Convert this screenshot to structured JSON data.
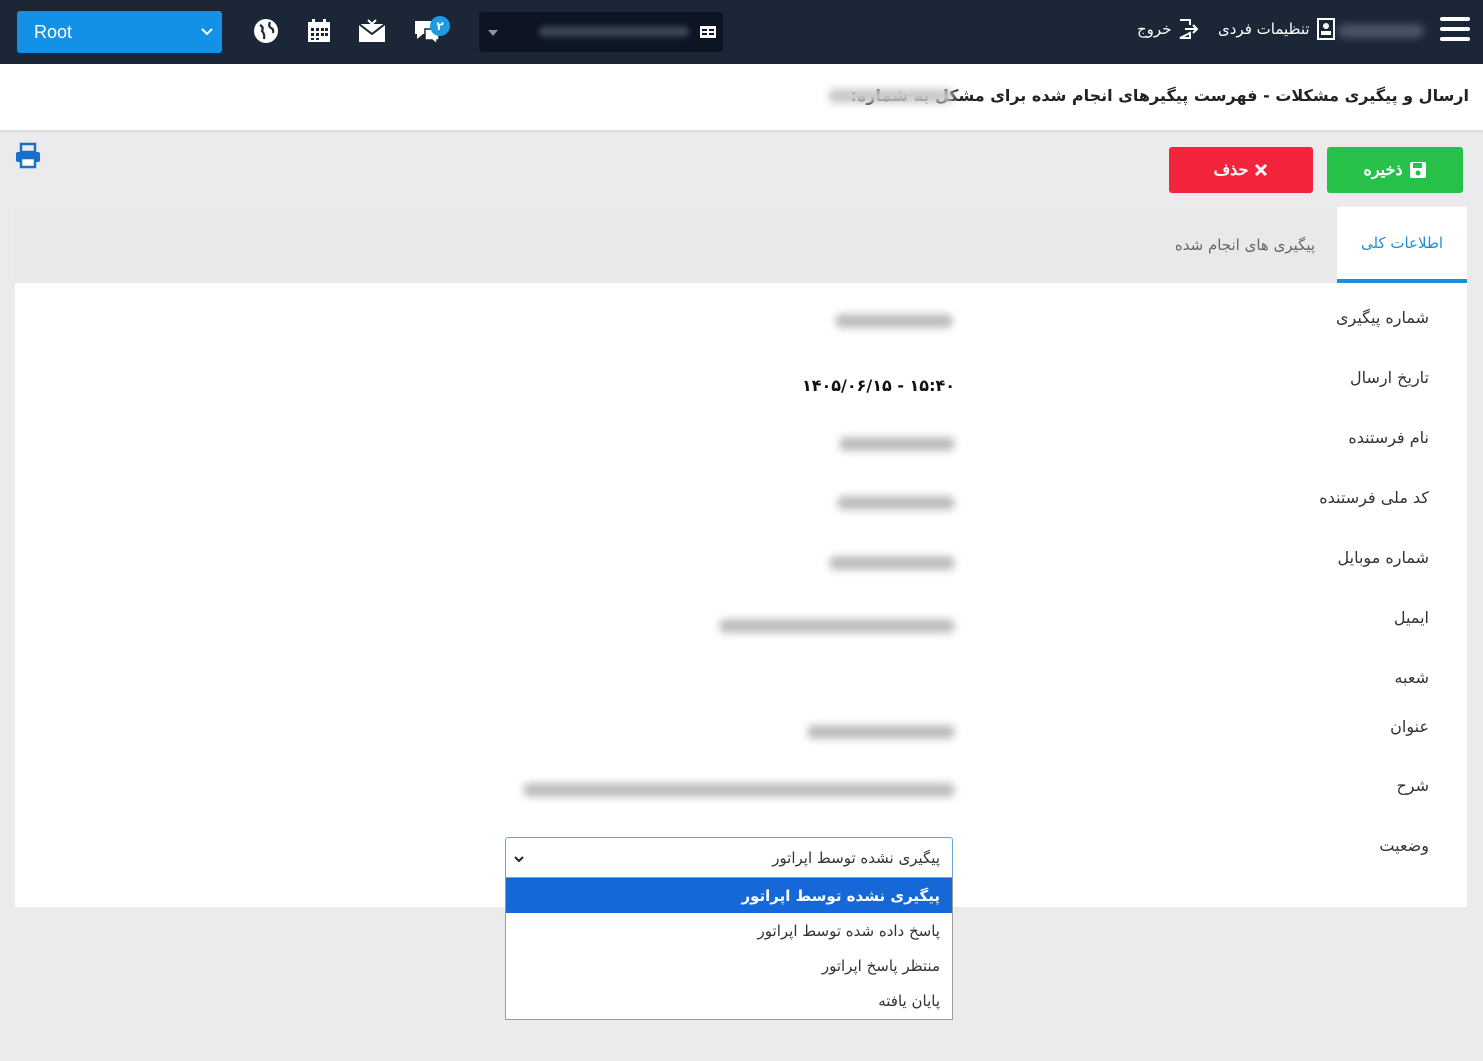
{
  "topbar": {
    "org_select_value": "Root",
    "chat_badge": "۲",
    "personal_settings": "تنظیمات فردی",
    "logout": "خروج"
  },
  "page": {
    "title": "ارسال و پیگیری مشکلات - فهرست پیگیرهای انجام شده برای مشکل به شماره:"
  },
  "toolbar": {
    "save_label": "ذخیره",
    "delete_label": "حذف"
  },
  "tabs": [
    {
      "label": "اطلاعات کلی",
      "active": true
    },
    {
      "label": "پیگیری های انجام شده",
      "active": false
    }
  ],
  "fields": {
    "tracking_number_label": "شماره پیگیری",
    "send_date_label": "تاریخ ارسال",
    "send_date_value": "۱۴۰۵/۰۶/۱۵ - ۱۵:۴۰",
    "sender_name_label": "نام فرستنده",
    "national_code_label": "کد ملی فرستنده",
    "mobile_label": "شماره موبایل",
    "email_label": "ایمیل",
    "branch_label": "شعبه",
    "subject_label": "عنوان",
    "description_label": "شرح",
    "status_label": "وضعیت"
  },
  "status": {
    "selected": "پیگیری نشده توسط اپراتور",
    "options": [
      "پیگیری نشده توسط اپراتور",
      "پاسخ داده شده توسط اپراتور",
      "منتظر پاسخ اپراتور",
      "پایان یافته"
    ]
  },
  "colors": {
    "topbar": "#1b2636",
    "accent": "#1e8fd6",
    "save": "#27c14a",
    "delete": "#f4243c",
    "dropdown_selected": "#1668d8"
  }
}
